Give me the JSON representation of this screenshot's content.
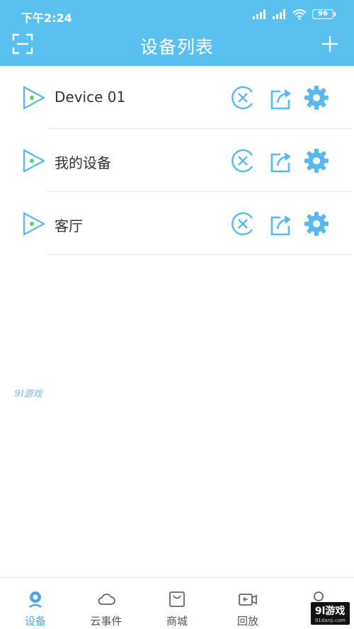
{
  "status_bar": {
    "time": "下午2:24",
    "battery": "96"
  },
  "header": {
    "title": "设备列表",
    "scan_icon": "scan-icon",
    "add_icon": "plus-icon"
  },
  "devices": [
    {
      "name": "Device 01"
    },
    {
      "name": "我的设备"
    },
    {
      "name": "客厅"
    }
  ],
  "tabs": [
    {
      "label": "设备",
      "icon": "device-icon",
      "active": true
    },
    {
      "label": "云事件",
      "icon": "cloud-icon",
      "active": false
    },
    {
      "label": "商城",
      "icon": "shop-icon",
      "active": false
    },
    {
      "label": "回放",
      "icon": "playback-icon",
      "active": false
    },
    {
      "label": "",
      "icon": "profile-icon",
      "active": false
    }
  ],
  "watermark": {
    "logo": "9l游戏",
    "site": "91danji.com"
  },
  "colors": {
    "accent": "#5ac0f0",
    "icon_blue": "#5ab8ec",
    "active_tab": "#4aa8e8",
    "play_dot": "#4cd964"
  }
}
